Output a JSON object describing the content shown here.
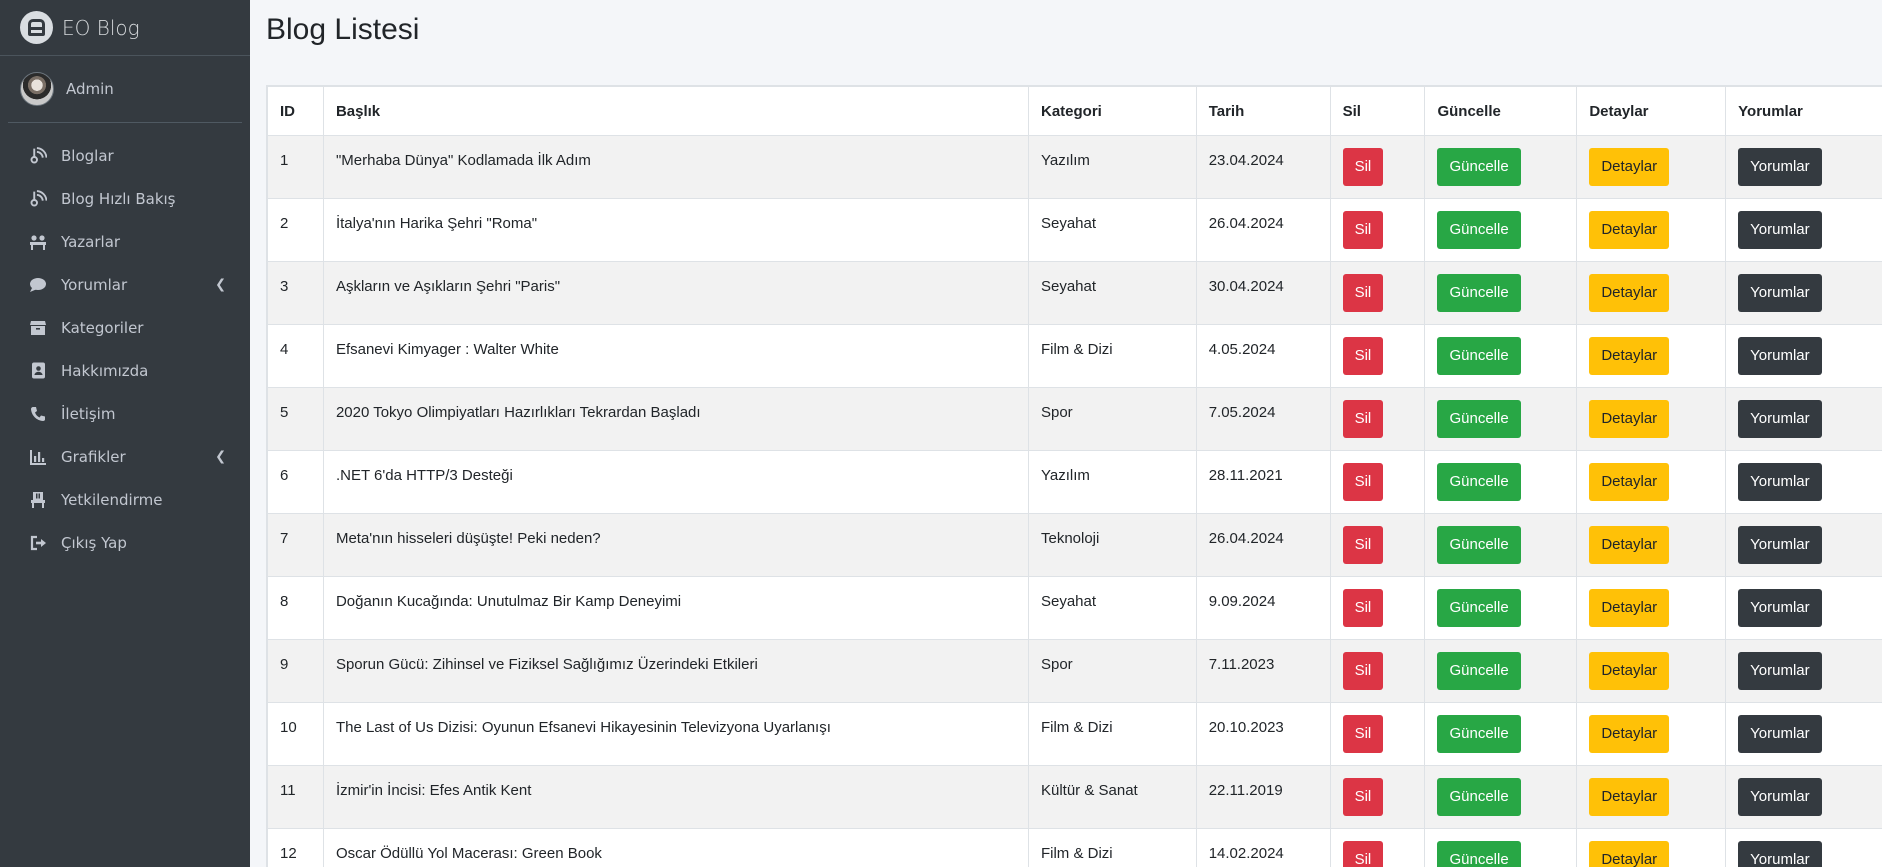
{
  "app": {
    "brand": "EO Blog",
    "user": "Admin"
  },
  "sidebar": {
    "items": [
      {
        "label": "Bloglar",
        "icon": "blog-icon"
      },
      {
        "label": "Blog Hızlı Bakış",
        "icon": "blog-icon"
      },
      {
        "label": "Yazarlar",
        "icon": "users-icon"
      },
      {
        "label": "Yorumlar",
        "icon": "comment-icon",
        "has_submenu": true
      },
      {
        "label": "Kategoriler",
        "icon": "box-icon"
      },
      {
        "label": "Hakkımızda",
        "icon": "address-book-icon"
      },
      {
        "label": "İletişim",
        "icon": "phone-icon"
      },
      {
        "label": "Grafikler",
        "icon": "chart-icon",
        "has_submenu": true
      },
      {
        "label": "Yetkilendirme",
        "icon": "chair-icon"
      },
      {
        "label": "Çıkış Yap",
        "icon": "logout-icon"
      }
    ]
  },
  "page": {
    "title": "Blog Listesi"
  },
  "table": {
    "headers": [
      "ID",
      "Başlık",
      "Kategori",
      "Tarih",
      "Sil",
      "Güncelle",
      "Detaylar",
      "Yorumlar"
    ],
    "buttons": {
      "delete": "Sil",
      "update": "Güncelle",
      "details": "Detaylar",
      "comments": "Yorumlar"
    },
    "rows": [
      {
        "id": "1",
        "title": "\"Merhaba Dünya\" Kodlamada İlk Adım",
        "category": "Yazılım",
        "date": "23.04.2024"
      },
      {
        "id": "2",
        "title": "İtalya'nın Harika Şehri \"Roma\"",
        "category": "Seyahat",
        "date": "26.04.2024"
      },
      {
        "id": "3",
        "title": "Aşkların ve Aşıkların Şehri \"Paris\"",
        "category": "Seyahat",
        "date": "30.04.2024"
      },
      {
        "id": "4",
        "title": "Efsanevi Kimyager : Walter White",
        "category": "Film & Dizi",
        "date": "4.05.2024"
      },
      {
        "id": "5",
        "title": "2020 Tokyo Olimpiyatları Hazırlıkları Tekrardan Başladı",
        "category": "Spor",
        "date": "7.05.2024"
      },
      {
        "id": "6",
        "title": ".NET 6'da HTTP/3 Desteği",
        "category": "Yazılım",
        "date": "28.11.2021"
      },
      {
        "id": "7",
        "title": "Meta'nın hisseleri düşüşte! Peki neden?",
        "category": "Teknoloji",
        "date": "26.04.2024"
      },
      {
        "id": "8",
        "title": "Doğanın Kucağında: Unutulmaz Bir Kamp Deneyimi",
        "category": "Seyahat",
        "date": "9.09.2024"
      },
      {
        "id": "9",
        "title": "Sporun Gücü: Zihinsel ve Fiziksel Sağlığımız Üzerindeki Etkileri",
        "category": "Spor",
        "date": "7.11.2023"
      },
      {
        "id": "10",
        "title": "The Last of Us Dizisi: Oyunun Efsanevi Hikayesinin Televizyona Uyarlanışı",
        "category": "Film & Dizi",
        "date": "20.10.2023"
      },
      {
        "id": "11",
        "title": "İzmir'in İncisi: Efes Antik Kent",
        "category": "Kültür & Sanat",
        "date": "22.11.2019"
      },
      {
        "id": "12",
        "title": "Oscar Ödüllü Yol Macerası: Green Book",
        "category": "Film & Dizi",
        "date": "14.02.2024"
      }
    ]
  },
  "colors": {
    "sidebar_bg": "#343a40",
    "danger": "#dc3545",
    "success": "#28a745",
    "warning": "#ffc107",
    "dark": "#343a40"
  }
}
